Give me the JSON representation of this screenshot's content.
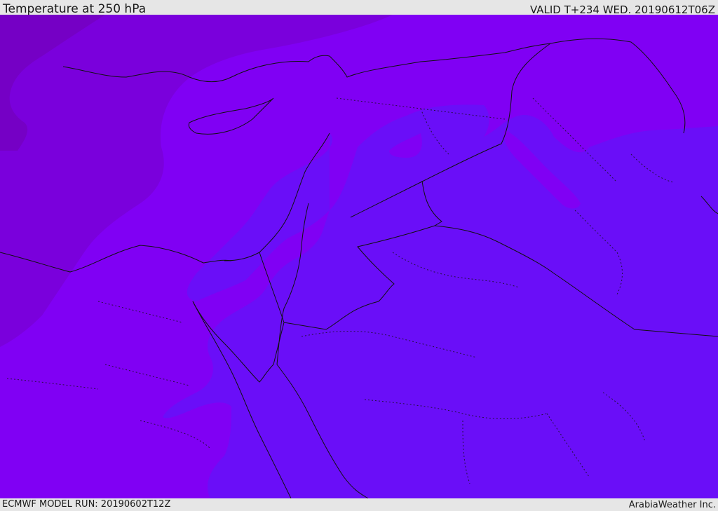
{
  "header": {
    "title": "Temperature at 250 hPa",
    "valid_time": "VALID T+234 WED. 20190612T06Z"
  },
  "footer": {
    "model_run": "ECMWF MODEL RUN: 20190602T12Z",
    "credit": "ArabiaWeather Inc."
  },
  "map": {
    "fill_colors": {
      "darkest": "#7500c5",
      "dark": "#7a00dc",
      "mid": "#8000f4",
      "light": "#6a0ef8",
      "lightest": "#6414fa"
    },
    "border_color": "#111111"
  }
}
